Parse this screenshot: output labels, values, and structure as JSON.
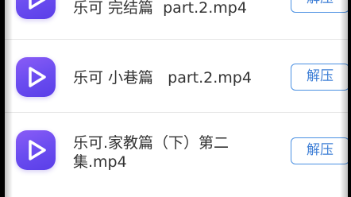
{
  "files": [
    {
      "name": "乐可 完结篇  part.2.mp4",
      "action_label": "解压"
    },
    {
      "name": "乐可 小巷篇   part.2.mp4",
      "action_label": "解压"
    },
    {
      "name": "乐可.家教篇（下）第二集.mp4",
      "action_label": "解压"
    }
  ],
  "colors": {
    "accent": "#4a90e2",
    "icon_purple": "#6b4df0"
  },
  "icons": {
    "file_icon": "play-icon"
  }
}
